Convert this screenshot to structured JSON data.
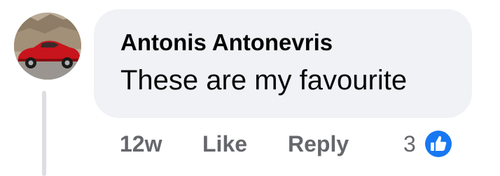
{
  "comment": {
    "author": "Antonis Antonevris",
    "text": "These are my favourite",
    "avatar_icon": "user-avatar-red-car"
  },
  "meta": {
    "timestamp": "12w",
    "like_label": "Like",
    "reply_label": "Reply"
  },
  "reactions": {
    "count": "3",
    "icon": "thumbs-up-icon",
    "color": "#1877f2"
  },
  "colors": {
    "bubble": "#f0f2f5",
    "text": "#050505",
    "secondary_text": "#65676b",
    "thread_line": "#dcdee2"
  }
}
